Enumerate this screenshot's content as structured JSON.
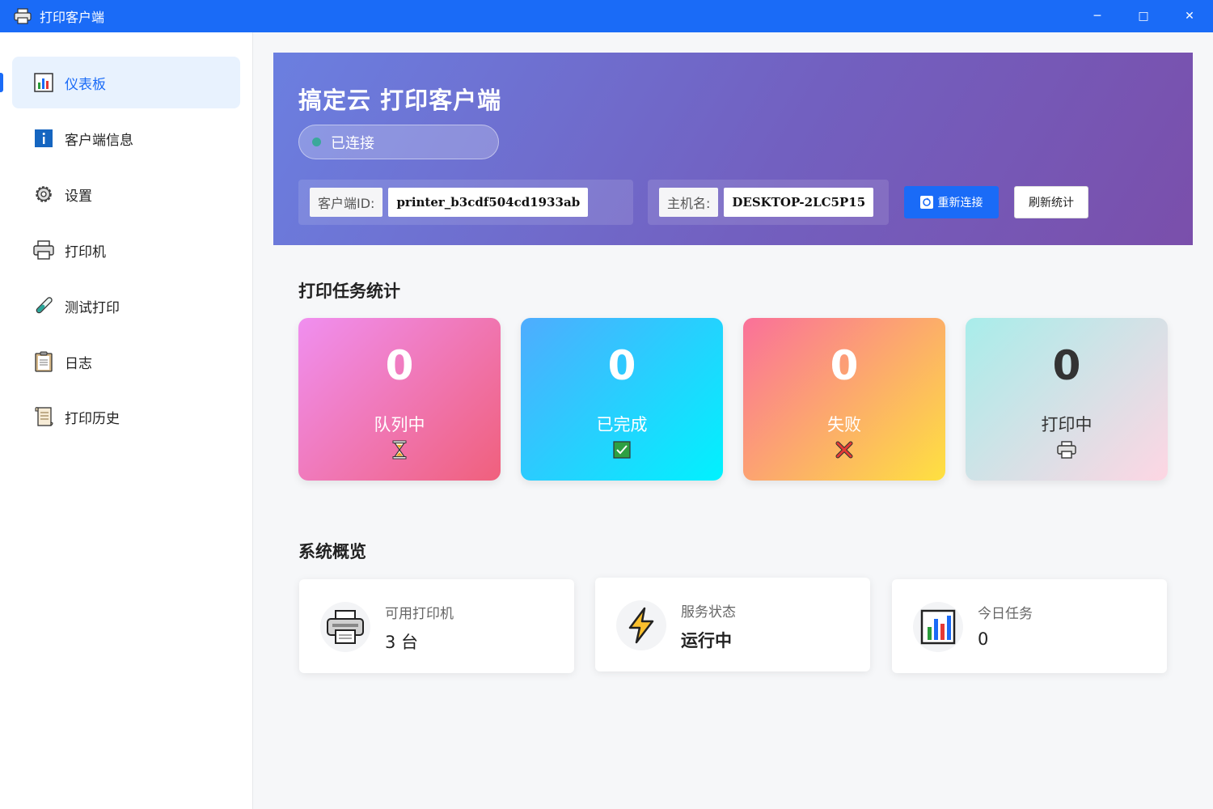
{
  "window": {
    "title": "打印客户端",
    "controls": {
      "minimize": "─",
      "maximize": "□",
      "close": "✕"
    }
  },
  "sidebar": {
    "items": [
      {
        "label": "仪表板",
        "icon": "bar-chart-icon",
        "active": true
      },
      {
        "label": "客户端信息",
        "icon": "info-icon",
        "active": false
      },
      {
        "label": "设置",
        "icon": "gear-icon",
        "active": false
      },
      {
        "label": "打印机",
        "icon": "printer-icon",
        "active": false
      },
      {
        "label": "测试打印",
        "icon": "test-tube-icon",
        "active": false
      },
      {
        "label": "日志",
        "icon": "clipboard-icon",
        "active": false
      },
      {
        "label": "打印历史",
        "icon": "scroll-icon",
        "active": false
      }
    ]
  },
  "hero": {
    "title": "搞定云 打印客户端",
    "status": "已连接",
    "client_id_label": "客户端ID:",
    "client_id_value": "printer_b3cdf504cd1933ab",
    "hostname_label": "主机名:",
    "hostname_value": "DESKTOP-2LC5P15",
    "reconnect_label": "重新连接",
    "refresh_label": "刷新统计"
  },
  "stats": {
    "section_title": "打印任务统计",
    "cards": [
      {
        "value": "0",
        "label": "队列中",
        "icon": "hourglass-icon"
      },
      {
        "value": "0",
        "label": "已完成",
        "icon": "check-box-icon"
      },
      {
        "value": "0",
        "label": "失败",
        "icon": "cross-icon"
      },
      {
        "value": "0",
        "label": "打印中",
        "icon": "printer-icon"
      }
    ]
  },
  "overview": {
    "section_title": "系统概览",
    "cards": [
      {
        "label": "可用打印机",
        "value": "3 台",
        "icon": "printer-icon"
      },
      {
        "label": "服务状态",
        "value": "运行中",
        "icon": "lightning-icon"
      },
      {
        "label": "今日任务",
        "value": "0",
        "icon": "bar-chart-icon"
      }
    ]
  },
  "colors": {
    "accent": "#1a6bf7",
    "status_dot": "#3aa89a"
  }
}
